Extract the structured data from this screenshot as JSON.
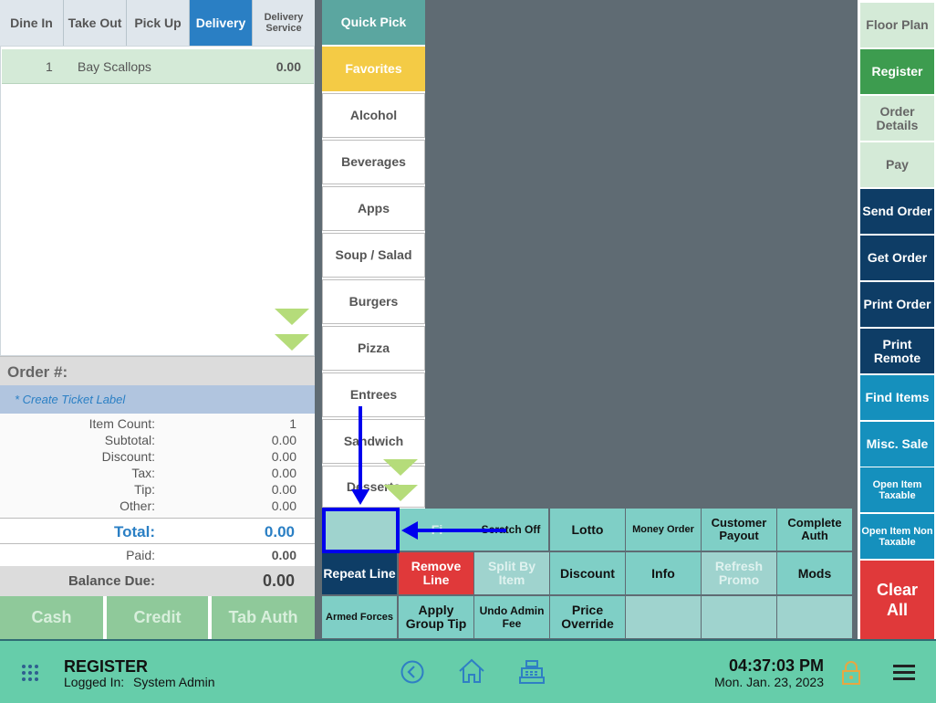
{
  "order_types": [
    {
      "label": "Dine In"
    },
    {
      "label": "Take Out"
    },
    {
      "label": "Pick Up"
    },
    {
      "label": "Delivery"
    },
    {
      "label": "Delivery Service"
    }
  ],
  "order_items": [
    {
      "qty": "1",
      "name": "Bay Scallops",
      "price": "0.00"
    }
  ],
  "order": {
    "order_number_label": "Order #:",
    "ticket_label": "* Create Ticket Label",
    "summary": [
      {
        "label": "Item Count:",
        "value": "1"
      },
      {
        "label": "Subtotal:",
        "value": "0.00"
      },
      {
        "label": "Discount:",
        "value": "0.00"
      },
      {
        "label": "Tax:",
        "value": "0.00"
      },
      {
        "label": "Tip:",
        "value": "0.00"
      },
      {
        "label": "Other:",
        "value": "0.00"
      }
    ],
    "total_label": "Total:",
    "total_value": "0.00",
    "paid_label": "Paid:",
    "paid_value": "0.00",
    "balance_label": "Balance Due:",
    "balance_value": "0.00"
  },
  "payments": [
    {
      "label": "Cash"
    },
    {
      "label": "Credit"
    },
    {
      "label": "Tab Auth"
    }
  ],
  "categories": [
    {
      "label": "Quick Pick"
    },
    {
      "label": "Favorites"
    },
    {
      "label": "Alcohol"
    },
    {
      "label": "Beverages"
    },
    {
      "label": "Apps"
    },
    {
      "label": "Soup / Salad"
    },
    {
      "label": "Burgers"
    },
    {
      "label": "Pizza"
    },
    {
      "label": "Entrees"
    },
    {
      "label": "Sandwich"
    },
    {
      "label": "Desserts"
    }
  ],
  "functions": {
    "row1": [
      {
        "label": ""
      },
      {
        "label": "Fi"
      },
      {
        "label": "Scratch Off"
      },
      {
        "label": "Lotto"
      },
      {
        "label": "Money Order"
      },
      {
        "label": "Customer Payout"
      },
      {
        "label": "Complete Auth"
      }
    ],
    "row2": [
      {
        "label": "Repeat Line"
      },
      {
        "label": "Remove Line"
      },
      {
        "label": "Split By Item"
      },
      {
        "label": "Discount"
      },
      {
        "label": "Info"
      },
      {
        "label": "Refresh Promo"
      },
      {
        "label": "Mods"
      }
    ],
    "row3": [
      {
        "label": "Armed Forces"
      },
      {
        "label": "Apply Group Tip"
      },
      {
        "label": "Undo Admin Fee"
      },
      {
        "label": "Price Override"
      },
      {
        "label": ""
      },
      {
        "label": ""
      },
      {
        "label": ""
      }
    ]
  },
  "right_buttons": [
    {
      "label": "Floor Plan"
    },
    {
      "label": "Register"
    },
    {
      "label": "Order Details"
    },
    {
      "label": "Pay"
    },
    {
      "label": "Send Order"
    },
    {
      "label": "Get Order"
    },
    {
      "label": "Print Order"
    },
    {
      "label": "Print Remote"
    },
    {
      "label": "Find Items"
    },
    {
      "label": "Misc. Sale"
    },
    {
      "label": "Open Item Taxable"
    },
    {
      "label": "Open Item Non Taxable"
    },
    {
      "label": "Clear All"
    }
  ],
  "footer": {
    "title": "REGISTER",
    "logged_in_label": "Logged In:",
    "user": "System Admin",
    "time": "04:37:03 PM",
    "date": "Mon. Jan. 23, 2023"
  },
  "icons": [
    "apps-grid-icon",
    "back-circle-icon",
    "home-icon",
    "cash-register-icon",
    "lock-icon",
    "menu-icon",
    "chevron-down-icon",
    "arrow-icon"
  ],
  "colors": {
    "footer": "#66cdaa",
    "delivery_active": "#2a7fc4",
    "favorites": "#f4cb45",
    "register": "#3d9c4f",
    "clear_all": "#e0393a",
    "highlight": "#0000ee"
  }
}
